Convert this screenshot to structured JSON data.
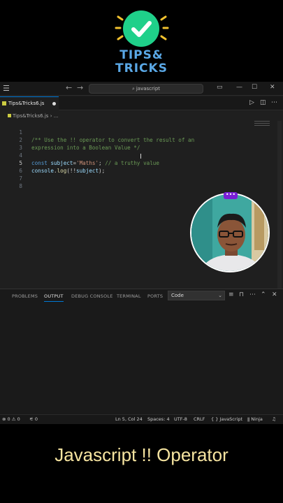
{
  "logo": {
    "line1": "TIPS&",
    "line2": "TRICKS",
    "check_icon": "check-icon",
    "accent": "#1fd08a",
    "text_color": "#5aa8e6"
  },
  "titlebar": {
    "search_text": "javascript",
    "search_icon": "search-icon"
  },
  "tabs": [
    {
      "label": "Tips&Tricks6.js",
      "modified": true
    }
  ],
  "breadcrumb": {
    "file": "Tips&Tricks6.js",
    "more": "..."
  },
  "editor": {
    "lines": [
      {
        "num": "1",
        "text": "/** Use the !! operator to convert the result of an"
      },
      {
        "num": "2",
        "text": "expression into a Boolean Value */"
      },
      {
        "num": "3",
        "text": ""
      },
      {
        "num": "4",
        "const": "const",
        "var": "subject",
        "eq": "=",
        "str": "'Maths'",
        "semi": "; ",
        "comment": "// a truthy value"
      },
      {
        "num": "5",
        "obj": "console",
        "dot": ".",
        "fn": "log",
        "open": "(!!",
        "arg": "subject",
        "close": ");"
      },
      {
        "num": "6",
        "text": ""
      },
      {
        "num": "7",
        "text": ""
      },
      {
        "num": "8",
        "text": ""
      }
    ]
  },
  "panel": {
    "tabs": [
      "PROBLEMS",
      "OUTPUT",
      "DEBUG CONSOLE",
      "TERMINAL",
      "PORTS"
    ],
    "active_tab": "OUTPUT",
    "select_value": "Code"
  },
  "statusbar": {
    "errors": "0",
    "warnings": "0",
    "ports": "0",
    "position": "Ln 5, Col 24",
    "spaces": "Spaces: 4",
    "encoding": "UTF-8",
    "eol": "CRLF",
    "language_icon": "{ }",
    "language": "JavaScript",
    "ninja": "Ninja"
  },
  "caption": "Javascript !! Operator",
  "colors": {
    "editor_bg": "#1f1f1f",
    "comment": "#6a9955",
    "keyword": "#569cd6",
    "string": "#ce9178",
    "caption": "#f6e4a0"
  }
}
